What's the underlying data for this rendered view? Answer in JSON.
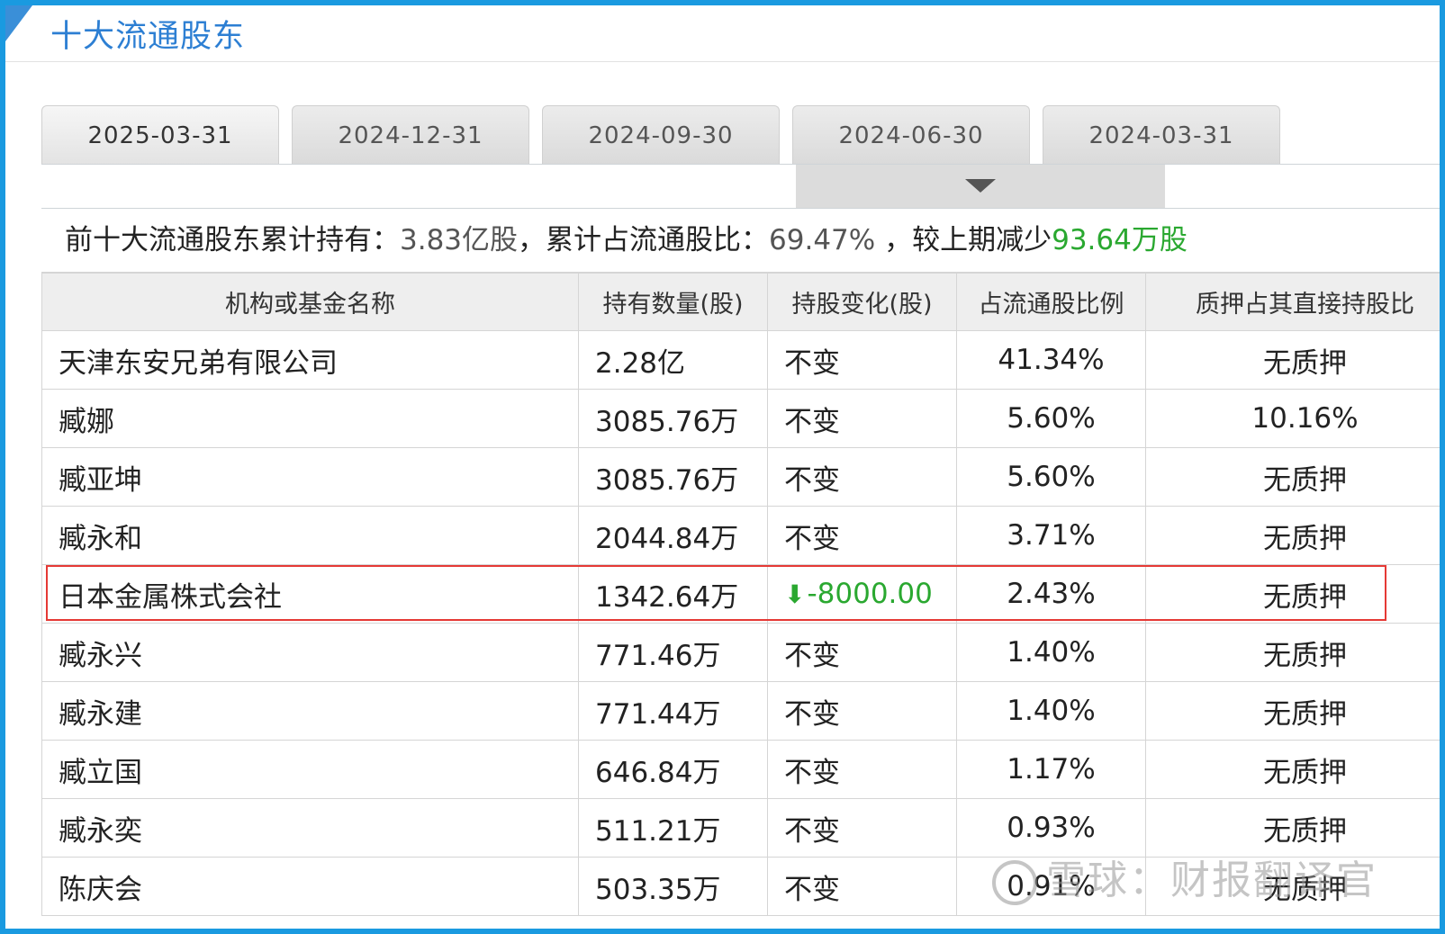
{
  "header": {
    "title": "十大流通股东"
  },
  "tabs": [
    {
      "label": "2025-03-31",
      "active": true
    },
    {
      "label": "2024-12-31",
      "active": false
    },
    {
      "label": "2024-09-30",
      "active": false
    },
    {
      "label": "2024-06-30",
      "active": false
    },
    {
      "label": "2024-03-31",
      "active": false
    }
  ],
  "summary": {
    "prefix": "前十大流通股东累计持有：",
    "total_shares": "3.83亿股",
    "mid": "，累计占流通股比：",
    "total_pct": "69.47%",
    "change_prefix": " ，较上期减少",
    "change_value": "93.64万股"
  },
  "table": {
    "columns": [
      "机构或基金名称",
      "持有数量(股)",
      "持股变化(股)",
      "占流通股比例",
      "质押占其直接持股比"
    ],
    "rows": [
      {
        "name": "天津东安兄弟有限公司",
        "qty": "2.28亿",
        "change": "不变",
        "pct": "41.34%",
        "pledge": "无质押"
      },
      {
        "name": "臧娜",
        "qty": "3085.76万",
        "change": "不变",
        "pct": "5.60%",
        "pledge": "10.16%"
      },
      {
        "name": "臧亚坤",
        "qty": "3085.76万",
        "change": "不变",
        "pct": "5.60%",
        "pledge": "无质押"
      },
      {
        "name": "臧永和",
        "qty": "2044.84万",
        "change": "不变",
        "pct": "3.71%",
        "pledge": "无质押"
      },
      {
        "name": "日本金属株式会社",
        "qty": "1342.64万",
        "change": "-8000.00",
        "pct": "2.43%",
        "pledge": "无质押",
        "decreased": true
      },
      {
        "name": "臧永兴",
        "qty": "771.46万",
        "change": "不变",
        "pct": "1.40%",
        "pledge": "无质押"
      },
      {
        "name": "臧永建",
        "qty": "771.44万",
        "change": "不变",
        "pct": "1.40%",
        "pledge": "无质押"
      },
      {
        "name": "臧立国",
        "qty": "646.84万",
        "change": "不变",
        "pct": "1.17%",
        "pledge": "无质押"
      },
      {
        "name": "臧永奕",
        "qty": "511.21万",
        "change": "不变",
        "pct": "0.93%",
        "pledge": "无质押"
      },
      {
        "name": "陈庆会",
        "qty": "503.35万",
        "change": "不变",
        "pct": "0.91%",
        "pledge": "无质押"
      }
    ]
  },
  "watermark": {
    "text": "雪球：财报翻译官"
  },
  "colors": {
    "frame": "#1a9ae0",
    "title": "#2d7fd3",
    "decrease": "#2aa830",
    "highlight": "#e53935"
  },
  "icons": {
    "toggle": "triangle-down-icon",
    "decrease": "arrow-down-icon"
  }
}
